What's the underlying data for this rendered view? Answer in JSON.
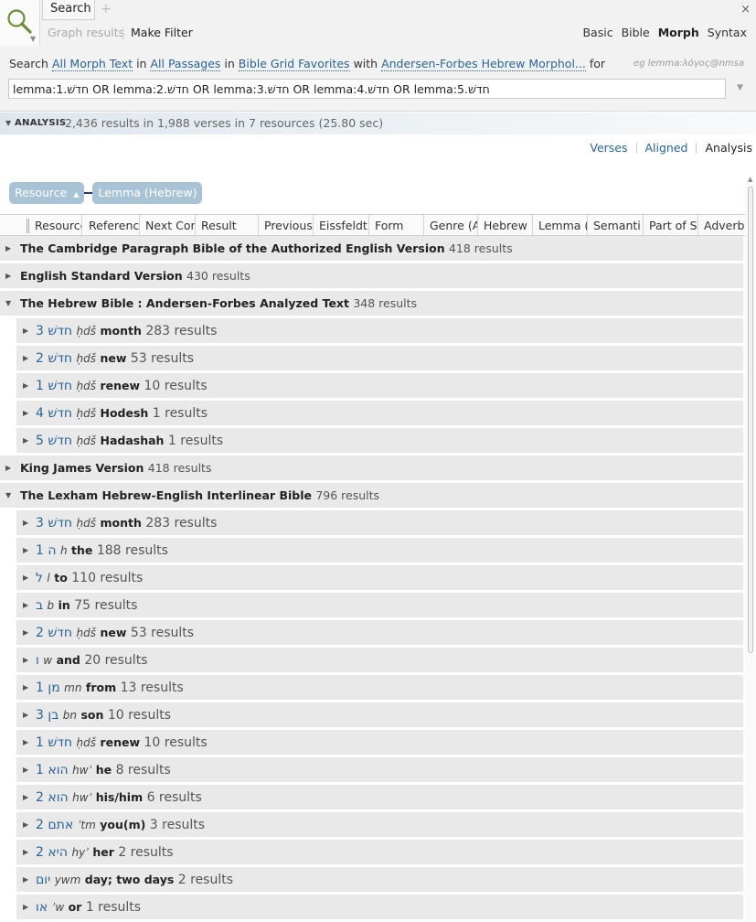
{
  "tabs": {
    "active_label": "Search",
    "add_label": "+",
    "close_label": "×"
  },
  "toolbar": {
    "graph_results": "Graph results",
    "make_filter": "Make Filter",
    "modes": [
      {
        "label": "Basic",
        "active": false
      },
      {
        "label": "Bible",
        "active": false
      },
      {
        "label": "Morph",
        "active": true
      },
      {
        "label": "Syntax",
        "active": false
      }
    ]
  },
  "search": {
    "w1": "Search",
    "scope": "All Morph Text",
    "w2": "in",
    "passages": "All Passages",
    "w3": "in",
    "collection": "Bible Grid Favorites",
    "w4": "with",
    "morph": "Andersen-Forbes Hebrew Morphol...",
    "w5": "for",
    "hint": "eg lemma:λόγος@nmsa",
    "query": "lemma:1.חדשׁ OR lemma:2.חדשׁ OR lemma:3.חדשׁ OR lemma:4.חדשׁ OR lemma:5.חדשׁ"
  },
  "analysis": {
    "label": "ANALYSIS",
    "summary": "2,436 results in 1,988 verses in 7 resources (25.80 sec)"
  },
  "view_tabs": [
    {
      "label": "Verses",
      "active": false
    },
    {
      "label": "Aligned",
      "active": false
    },
    {
      "label": "Analysis",
      "active": true
    }
  ],
  "group_chips": {
    "resource": "Resource",
    "lemma": "Lemma (Hebrew)"
  },
  "columns": [
    "Resource",
    "Referenc",
    "Next Cor",
    "Result",
    "Previous",
    "Eissfeldt",
    "Form",
    "Genre (A",
    "Hebrew",
    "Lemma (",
    "Semanti",
    "Part of S",
    "Adverbi"
  ],
  "rows": [
    {
      "level": 1,
      "open": false,
      "name": "The Cambridge Paragraph Bible of the Authorized English Version",
      "count": "418 results"
    },
    {
      "level": 1,
      "open": false,
      "name": "English Standard Version",
      "count": "430 results"
    },
    {
      "level": 1,
      "open": true,
      "name": "The Hebrew Bible : Andersen-Forbes Analyzed Text",
      "count": "348 results"
    },
    {
      "level": 2,
      "num": "3",
      "heb": "חדשׁ",
      "translit": "ḥdš",
      "gloss": "month",
      "count": "283 results"
    },
    {
      "level": 2,
      "num": "2",
      "heb": "חדשׁ",
      "translit": "ḥdš",
      "gloss": "new",
      "count": "53 results"
    },
    {
      "level": 2,
      "num": "1",
      "heb": "חדשׁ",
      "translit": "ḥdš",
      "gloss": "renew",
      "count": "10 results"
    },
    {
      "level": 2,
      "num": "4",
      "heb": "חדשׁ",
      "translit": "ḥdš",
      "gloss": "Hodesh",
      "count": "1 results"
    },
    {
      "level": 2,
      "num": "5",
      "heb": "חדשׁ",
      "translit": "ḥdš",
      "gloss": "Hadashah",
      "count": "1 results"
    },
    {
      "level": 1,
      "open": false,
      "name": "King James Version",
      "count": "418 results"
    },
    {
      "level": 1,
      "open": true,
      "name": "The Lexham Hebrew-English Interlinear Bible",
      "count": "796 results"
    },
    {
      "level": 2,
      "num": "3",
      "heb": "חדשׁ",
      "translit": "ḥdš",
      "gloss": "month",
      "count": "283 results"
    },
    {
      "level": 2,
      "num": "1",
      "heb": "ה",
      "translit": "h",
      "gloss": "the",
      "count": "188 results"
    },
    {
      "level": 2,
      "num": "",
      "heb": "ל",
      "translit": "l",
      "gloss": "to",
      "count": "110 results"
    },
    {
      "level": 2,
      "num": "",
      "heb": "ב",
      "translit": "b",
      "gloss": "in",
      "count": "75 results"
    },
    {
      "level": 2,
      "num": "2",
      "heb": "חדשׁ",
      "translit": "ḥdš",
      "gloss": "new",
      "count": "53 results"
    },
    {
      "level": 2,
      "num": "",
      "heb": "ו",
      "translit": "w",
      "gloss": "and",
      "count": "20 results"
    },
    {
      "level": 2,
      "num": "1",
      "heb": "מן",
      "translit": "mn",
      "gloss": "from",
      "count": "13 results"
    },
    {
      "level": 2,
      "num": "3",
      "heb": "בן",
      "translit": "bn",
      "gloss": "son",
      "count": "10 results"
    },
    {
      "level": 2,
      "num": "1",
      "heb": "חדשׁ",
      "translit": "ḥdš",
      "gloss": "renew",
      "count": "10 results"
    },
    {
      "level": 2,
      "num": "1",
      "heb": "הוא",
      "translit": "hwʾ",
      "gloss": "he",
      "count": "8 results"
    },
    {
      "level": 2,
      "num": "2",
      "heb": "הוא",
      "translit": "hwʾ",
      "gloss": "his/him",
      "count": "6 results"
    },
    {
      "level": 2,
      "num": "2",
      "heb": "אתם",
      "translit": "ʾtm",
      "gloss": "you(m)",
      "count": "3 results"
    },
    {
      "level": 2,
      "num": "2",
      "heb": "היא",
      "translit": "hyʾ",
      "gloss": "her",
      "count": "2 results"
    },
    {
      "level": 2,
      "num": "",
      "heb": "יום",
      "translit": "ywm",
      "gloss": "day; two days",
      "count": "2 results"
    },
    {
      "level": 2,
      "num": "",
      "heb": "או",
      "translit": "ʾw",
      "gloss": "or",
      "count": "1 results"
    }
  ]
}
